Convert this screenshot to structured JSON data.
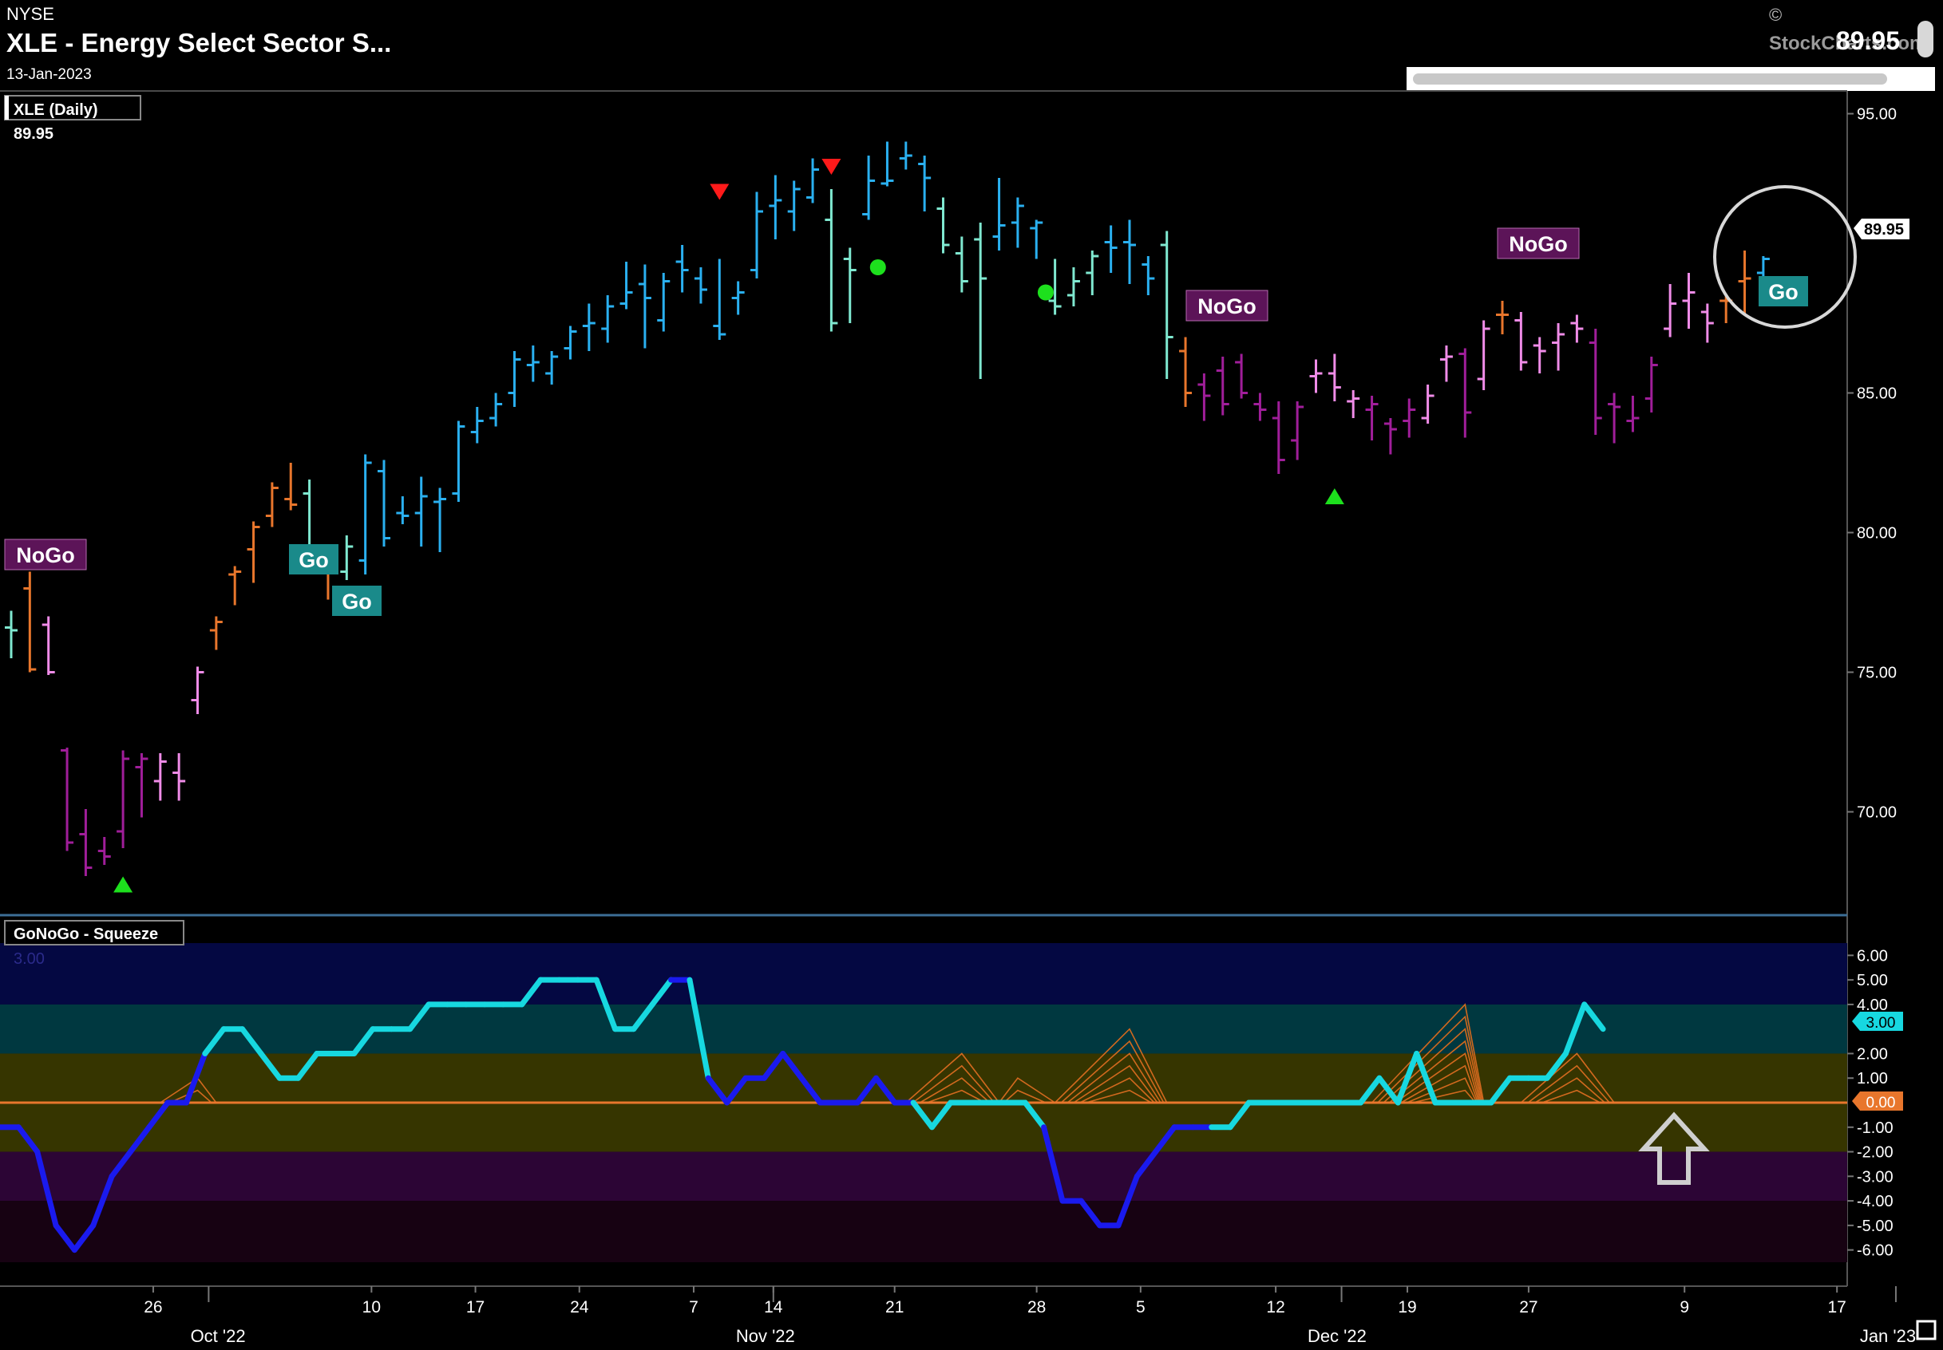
{
  "header": {
    "exchange": "NYSE",
    "title": "XLE - Energy Select Sector S...",
    "date": "13-Jan-2023",
    "last_price": "89.95",
    "copyright": "©",
    "brand": "StockCharts.com"
  },
  "price_panel": {
    "label": "XLE (Daily)",
    "value": "89.95",
    "price_tag": "89.95",
    "y_ticks": [
      "95.00",
      "85.00",
      "80.00",
      "75.00",
      "70.00"
    ]
  },
  "indicator_panel": {
    "label": "GoNoGo - Squeeze",
    "ghost_value": "3.00",
    "value_tag": "3.00",
    "zero_tag": "0.00",
    "y_ticks": [
      "6.00",
      "5.00",
      "4.00",
      "2.00",
      "1.00",
      "-1.00",
      "-2.00",
      "-3.00",
      "-4.00",
      "-5.00",
      "-6.00"
    ]
  },
  "x_axis": {
    "day_ticks": [
      "26",
      "10",
      "17",
      "24",
      "7",
      "14",
      "21",
      "28",
      "5",
      "12",
      "19",
      "27",
      "9",
      "17"
    ],
    "month_ticks": [
      "Oct '22",
      "Nov '22",
      "Dec '22",
      "Jan '23"
    ]
  },
  "colors": {
    "go_strong": "#2ab0f0",
    "go_weak": "#7fe8d0",
    "neutral": "#e8762c",
    "nogo_weak": "#f08ce8",
    "nogo_strong": "#a01e9a",
    "squeeze_line": "#17d8e0",
    "squeeze_line_dark": "#1a1aee",
    "zero_line": "#e8762c"
  },
  "annotations": {
    "labels": [
      {
        "text": "NoGo",
        "type": "nogo"
      },
      {
        "text": "Go",
        "type": "go"
      },
      {
        "text": "Go",
        "type": "go"
      },
      {
        "text": "NoGo",
        "type": "nogo"
      },
      {
        "text": "NoGo",
        "type": "nogo"
      },
      {
        "text": "Go",
        "type": "go"
      }
    ]
  },
  "chart_data": [
    {
      "type": "ohlc",
      "title": "XLE (Daily)",
      "ylim": [
        66.5,
        95.5
      ],
      "y_scale": "linear",
      "bars": [
        {
          "x": 0,
          "o": 76.6,
          "h": 77.2,
          "l": 75.5,
          "c": 76.5,
          "color": "go_weak"
        },
        {
          "x": 1,
          "o": 78.0,
          "h": 78.6,
          "l": 75.0,
          "c": 75.1,
          "color": "neutral"
        },
        {
          "x": 2,
          "o": 76.7,
          "h": 77.0,
          "l": 74.9,
          "c": 75.0,
          "color": "nogo_weak"
        },
        {
          "x": 3,
          "o": 72.2,
          "h": 72.3,
          "l": 68.6,
          "c": 68.9,
          "color": "nogo_strong"
        },
        {
          "x": 4,
          "o": 69.2,
          "h": 70.1,
          "l": 67.7,
          "c": 68.0,
          "color": "nogo_strong"
        },
        {
          "x": 5,
          "o": 68.6,
          "h": 69.1,
          "l": 68.1,
          "c": 68.4,
          "color": "nogo_strong"
        },
        {
          "x": 6,
          "o": 69.3,
          "h": 72.2,
          "l": 68.7,
          "c": 71.9,
          "color": "nogo_strong"
        },
        {
          "x": 7,
          "o": 71.6,
          "h": 72.1,
          "l": 69.8,
          "c": 71.9,
          "color": "nogo_strong"
        },
        {
          "x": 8,
          "o": 71.1,
          "h": 72.1,
          "l": 70.4,
          "c": 71.8,
          "color": "nogo_weak"
        },
        {
          "x": 9,
          "o": 71.4,
          "h": 72.1,
          "l": 70.4,
          "c": 71.1,
          "color": "nogo_weak"
        },
        {
          "x": 10,
          "o": 74.0,
          "h": 75.2,
          "l": 73.5,
          "c": 75.0,
          "color": "nogo_weak"
        },
        {
          "x": 11,
          "o": 76.5,
          "h": 77.0,
          "l": 75.8,
          "c": 76.8,
          "color": "neutral"
        },
        {
          "x": 12,
          "o": 78.5,
          "h": 78.8,
          "l": 77.4,
          "c": 78.6,
          "color": "neutral"
        },
        {
          "x": 13,
          "o": 79.4,
          "h": 80.4,
          "l": 78.2,
          "c": 80.2,
          "color": "neutral"
        },
        {
          "x": 14,
          "o": 80.6,
          "h": 81.8,
          "l": 80.2,
          "c": 81.6,
          "color": "neutral"
        },
        {
          "x": 15,
          "o": 81.2,
          "h": 82.5,
          "l": 80.8,
          "c": 81.0,
          "color": "neutral"
        },
        {
          "x": 16,
          "o": 81.4,
          "h": 81.9,
          "l": 79.3,
          "c": 79.4,
          "color": "go_weak"
        },
        {
          "x": 17,
          "o": 78.8,
          "h": 79.4,
          "l": 77.6,
          "c": 78.7,
          "color": "neutral"
        },
        {
          "x": 18,
          "o": 78.6,
          "h": 79.9,
          "l": 78.3,
          "c": 79.5,
          "color": "go_weak"
        },
        {
          "x": 19,
          "o": 79.0,
          "h": 82.8,
          "l": 78.5,
          "c": 82.5,
          "color": "go_strong"
        },
        {
          "x": 20,
          "o": 82.2,
          "h": 82.6,
          "l": 79.5,
          "c": 79.8,
          "color": "go_strong"
        },
        {
          "x": 21,
          "o": 80.7,
          "h": 81.3,
          "l": 80.3,
          "c": 80.6,
          "color": "go_strong"
        },
        {
          "x": 22,
          "o": 80.7,
          "h": 82.0,
          "l": 79.5,
          "c": 81.3,
          "color": "go_strong"
        },
        {
          "x": 23,
          "o": 81.1,
          "h": 81.6,
          "l": 79.3,
          "c": 81.2,
          "color": "go_strong"
        },
        {
          "x": 24,
          "o": 81.4,
          "h": 84.0,
          "l": 81.1,
          "c": 83.8,
          "color": "go_strong"
        },
        {
          "x": 25,
          "o": 83.6,
          "h": 84.5,
          "l": 83.2,
          "c": 84.0,
          "color": "go_strong"
        },
        {
          "x": 26,
          "o": 84.1,
          "h": 85.0,
          "l": 83.8,
          "c": 84.6,
          "color": "go_strong"
        },
        {
          "x": 27,
          "o": 85.0,
          "h": 86.5,
          "l": 84.5,
          "c": 86.2,
          "color": "go_strong"
        },
        {
          "x": 28,
          "o": 86.0,
          "h": 86.7,
          "l": 85.4,
          "c": 86.1,
          "color": "go_strong"
        },
        {
          "x": 29,
          "o": 85.7,
          "h": 86.5,
          "l": 85.3,
          "c": 86.3,
          "color": "go_strong"
        },
        {
          "x": 30,
          "o": 86.6,
          "h": 87.4,
          "l": 86.2,
          "c": 87.2,
          "color": "go_strong"
        },
        {
          "x": 31,
          "o": 87.4,
          "h": 88.2,
          "l": 86.5,
          "c": 87.5,
          "color": "go_strong"
        },
        {
          "x": 32,
          "o": 87.3,
          "h": 88.5,
          "l": 86.8,
          "c": 88.1,
          "color": "go_strong"
        },
        {
          "x": 33,
          "o": 88.2,
          "h": 89.7,
          "l": 88.0,
          "c": 88.6,
          "color": "go_strong"
        },
        {
          "x": 34,
          "o": 88.9,
          "h": 89.6,
          "l": 86.6,
          "c": 88.4,
          "color": "go_strong"
        },
        {
          "x": 35,
          "o": 87.6,
          "h": 89.3,
          "l": 87.2,
          "c": 89.0,
          "color": "go_strong"
        },
        {
          "x": 36,
          "o": 89.7,
          "h": 90.3,
          "l": 88.6,
          "c": 89.4,
          "color": "go_strong"
        },
        {
          "x": 37,
          "o": 89.1,
          "h": 89.5,
          "l": 88.2,
          "c": 88.7,
          "color": "go_strong"
        },
        {
          "x": 38,
          "o": 87.4,
          "h": 89.8,
          "l": 86.9,
          "c": 87.1,
          "color": "go_strong"
        },
        {
          "x": 39,
          "o": 88.4,
          "h": 89.0,
          "l": 87.8,
          "c": 88.6,
          "color": "go_strong"
        },
        {
          "x": 40,
          "o": 89.4,
          "h": 92.2,
          "l": 89.1,
          "c": 91.5,
          "color": "go_strong"
        },
        {
          "x": 41,
          "o": 91.7,
          "h": 92.8,
          "l": 90.5,
          "c": 91.9,
          "color": "go_strong"
        },
        {
          "x": 42,
          "o": 91.5,
          "h": 92.6,
          "l": 90.8,
          "c": 92.3,
          "color": "go_strong"
        },
        {
          "x": 43,
          "o": 92.0,
          "h": 93.4,
          "l": 91.8,
          "c": 93.0,
          "color": "go_strong"
        },
        {
          "x": 44,
          "o": 91.2,
          "h": 92.3,
          "l": 87.2,
          "c": 87.5,
          "color": "go_weak"
        },
        {
          "x": 45,
          "o": 89.8,
          "h": 90.2,
          "l": 87.5,
          "c": 89.4,
          "color": "go_weak"
        },
        {
          "x": 46,
          "o": 91.4,
          "h": 93.5,
          "l": 91.2,
          "c": 92.6,
          "color": "go_strong"
        },
        {
          "x": 47,
          "o": 92.5,
          "h": 94.0,
          "l": 92.4,
          "c": 92.6,
          "color": "go_strong"
        },
        {
          "x": 48,
          "o": 93.4,
          "h": 94.0,
          "l": 93.0,
          "c": 93.5,
          "color": "go_strong"
        },
        {
          "x": 49,
          "o": 93.2,
          "h": 93.5,
          "l": 91.5,
          "c": 92.7,
          "color": "go_strong"
        },
        {
          "x": 50,
          "o": 91.6,
          "h": 92.0,
          "l": 90.0,
          "c": 90.3,
          "color": "go_weak"
        },
        {
          "x": 51,
          "o": 90.0,
          "h": 90.6,
          "l": 88.6,
          "c": 89.0,
          "color": "go_weak"
        },
        {
          "x": 52,
          "o": 90.5,
          "h": 91.1,
          "l": 85.5,
          "c": 89.1,
          "color": "go_weak"
        },
        {
          "x": 53,
          "o": 90.6,
          "h": 92.7,
          "l": 90.1,
          "c": 91.0,
          "color": "go_strong"
        },
        {
          "x": 54,
          "o": 91.1,
          "h": 92.0,
          "l": 90.2,
          "c": 91.7,
          "color": "go_strong"
        },
        {
          "x": 55,
          "o": 90.9,
          "h": 91.2,
          "l": 89.8,
          "c": 91.1,
          "color": "go_strong"
        },
        {
          "x": 56,
          "o": 88.3,
          "h": 89.8,
          "l": 87.8,
          "c": 88.1,
          "color": "go_weak"
        },
        {
          "x": 57,
          "o": 88.5,
          "h": 89.5,
          "l": 88.1,
          "c": 89.0,
          "color": "go_weak"
        },
        {
          "x": 58,
          "o": 89.3,
          "h": 90.1,
          "l": 88.5,
          "c": 89.9,
          "color": "go_weak"
        },
        {
          "x": 59,
          "o": 90.4,
          "h": 91.0,
          "l": 89.3,
          "c": 90.2,
          "color": "go_strong"
        },
        {
          "x": 60,
          "o": 90.4,
          "h": 91.2,
          "l": 88.9,
          "c": 90.3,
          "color": "go_strong"
        },
        {
          "x": 61,
          "o": 89.6,
          "h": 89.9,
          "l": 88.5,
          "c": 89.1,
          "color": "go_strong"
        },
        {
          "x": 62,
          "o": 90.3,
          "h": 90.8,
          "l": 85.5,
          "c": 87.0,
          "color": "go_weak"
        },
        {
          "x": 63,
          "o": 86.5,
          "h": 87.0,
          "l": 84.5,
          "c": 85.0,
          "color": "neutral"
        },
        {
          "x": 64,
          "o": 85.3,
          "h": 85.7,
          "l": 84.0,
          "c": 84.9,
          "color": "nogo_strong"
        },
        {
          "x": 65,
          "o": 85.8,
          "h": 86.3,
          "l": 84.2,
          "c": 84.6,
          "color": "nogo_strong"
        },
        {
          "x": 66,
          "o": 86.1,
          "h": 86.4,
          "l": 84.8,
          "c": 85.0,
          "color": "nogo_strong"
        },
        {
          "x": 67,
          "o": 84.6,
          "h": 85.0,
          "l": 84.0,
          "c": 84.4,
          "color": "nogo_strong"
        },
        {
          "x": 68,
          "o": 84.1,
          "h": 84.7,
          "l": 82.1,
          "c": 82.6,
          "color": "nogo_strong"
        },
        {
          "x": 69,
          "o": 83.3,
          "h": 84.7,
          "l": 82.6,
          "c": 84.5,
          "color": "nogo_strong"
        },
        {
          "x": 70,
          "o": 85.6,
          "h": 86.2,
          "l": 85.0,
          "c": 85.7,
          "color": "nogo_weak"
        },
        {
          "x": 71,
          "o": 85.7,
          "h": 86.4,
          "l": 84.7,
          "c": 85.2,
          "color": "nogo_weak"
        },
        {
          "x": 72,
          "o": 84.7,
          "h": 85.1,
          "l": 84.1,
          "c": 84.8,
          "color": "nogo_weak"
        },
        {
          "x": 73,
          "o": 84.4,
          "h": 84.9,
          "l": 83.3,
          "c": 84.6,
          "color": "nogo_strong"
        },
        {
          "x": 74,
          "o": 83.9,
          "h": 84.1,
          "l": 82.8,
          "c": 83.7,
          "color": "nogo_strong"
        },
        {
          "x": 75,
          "o": 84.0,
          "h": 84.8,
          "l": 83.4,
          "c": 84.4,
          "color": "nogo_strong"
        },
        {
          "x": 76,
          "o": 84.1,
          "h": 85.3,
          "l": 83.9,
          "c": 84.9,
          "color": "nogo_weak"
        },
        {
          "x": 77,
          "o": 86.2,
          "h": 86.7,
          "l": 85.4,
          "c": 86.3,
          "color": "nogo_weak"
        },
        {
          "x": 78,
          "o": 86.4,
          "h": 86.6,
          "l": 83.4,
          "c": 84.3,
          "color": "nogo_strong"
        },
        {
          "x": 79,
          "o": 85.5,
          "h": 87.6,
          "l": 85.1,
          "c": 87.3,
          "color": "nogo_weak"
        },
        {
          "x": 80,
          "o": 87.8,
          "h": 88.3,
          "l": 87.1,
          "c": 87.8,
          "color": "neutral"
        },
        {
          "x": 81,
          "o": 87.6,
          "h": 87.9,
          "l": 85.8,
          "c": 86.1,
          "color": "nogo_weak"
        },
        {
          "x": 82,
          "o": 86.7,
          "h": 87.0,
          "l": 85.7,
          "c": 86.5,
          "color": "nogo_weak"
        },
        {
          "x": 83,
          "o": 86.8,
          "h": 87.5,
          "l": 85.8,
          "c": 87.1,
          "color": "nogo_weak"
        },
        {
          "x": 84,
          "o": 87.5,
          "h": 87.8,
          "l": 86.8,
          "c": 87.3,
          "color": "nogo_weak"
        },
        {
          "x": 85,
          "o": 86.8,
          "h": 87.3,
          "l": 83.5,
          "c": 84.1,
          "color": "nogo_strong"
        },
        {
          "x": 86,
          "o": 84.6,
          "h": 85.0,
          "l": 83.2,
          "c": 84.5,
          "color": "nogo_strong"
        },
        {
          "x": 87,
          "o": 84.0,
          "h": 84.9,
          "l": 83.6,
          "c": 84.1,
          "color": "nogo_strong"
        },
        {
          "x": 88,
          "o": 84.8,
          "h": 86.3,
          "l": 84.3,
          "c": 86.0,
          "color": "nogo_strong"
        },
        {
          "x": 89,
          "o": 87.3,
          "h": 88.9,
          "l": 87.0,
          "c": 88.2,
          "color": "nogo_weak"
        },
        {
          "x": 90,
          "o": 88.3,
          "h": 89.3,
          "l": 87.3,
          "c": 88.6,
          "color": "nogo_weak"
        },
        {
          "x": 91,
          "o": 87.9,
          "h": 88.2,
          "l": 86.8,
          "c": 87.5,
          "color": "nogo_weak"
        },
        {
          "x": 92,
          "o": 88.3,
          "h": 88.5,
          "l": 87.5,
          "c": 88.3,
          "color": "neutral"
        },
        {
          "x": 93,
          "o": 89.0,
          "h": 90.1,
          "l": 87.8,
          "c": 89.1,
          "color": "neutral"
        },
        {
          "x": 94,
          "o": 89.3,
          "h": 89.9,
          "l": 88.8,
          "c": 89.8,
          "color": "go_strong"
        }
      ]
    },
    {
      "type": "line",
      "title": "GoNoGo - Squeeze",
      "ylim": [
        -6.5,
        6.5
      ],
      "y_scale": "linear",
      "zero_line": 0,
      "series": [
        {
          "values": [
            -1,
            -1,
            -2,
            -5,
            -6,
            -5,
            -3,
            -2,
            -1,
            0,
            0,
            2,
            3,
            3,
            2,
            1,
            1,
            2,
            2,
            2,
            3,
            3,
            3,
            4,
            4,
            4,
            4,
            4,
            4,
            5,
            5,
            5,
            5,
            3,
            3,
            4,
            5,
            5,
            1,
            0,
            1,
            1,
            2,
            1,
            0,
            0,
            0,
            1,
            0,
            0,
            -1,
            0,
            0,
            0,
            0,
            0,
            -1,
            -4,
            -4,
            -5,
            -5,
            -3,
            -2,
            -1,
            -1,
            -1,
            -1,
            0,
            0,
            0,
            0,
            0,
            0,
            0,
            1,
            0,
            2,
            0,
            0,
            0,
            0,
            1,
            1,
            1,
            2,
            4,
            3
          ],
          "dark_segments": [
            [
              0,
              11
            ],
            [
              36,
              37
            ],
            [
              38,
              49
            ],
            [
              56,
              65
            ]
          ]
        }
      ],
      "squeeze_fans": [
        {
          "start": 8,
          "peak": 10,
          "end": 11,
          "height": 1.0
        },
        {
          "start": 48,
          "peak": 51,
          "end": 53,
          "height": 2.0
        },
        {
          "start": 53,
          "peak": 54,
          "end": 56,
          "height": 1.0
        },
        {
          "start": 56,
          "peak": 60,
          "end": 62,
          "height": 3.0
        },
        {
          "start": 73,
          "peak": 78,
          "end": 79,
          "height": 4.0
        },
        {
          "start": 81,
          "peak": 84,
          "end": 86,
          "height": 2.0
        }
      ]
    }
  ]
}
